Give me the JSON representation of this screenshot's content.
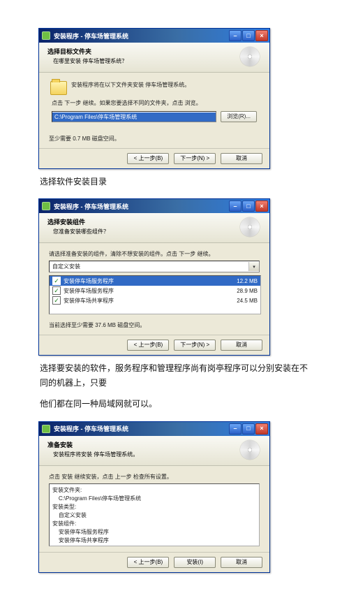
{
  "common": {
    "title": "安装程序 - 停车场管理系统",
    "minimize": "–",
    "maximize": "□",
    "close": "×",
    "prev": "< 上一步(B)",
    "next": "下一步(N) >",
    "cancel": "取消",
    "install": "安装(I)"
  },
  "d1": {
    "h1": "选择目标文件夹",
    "h2": "在哪里安装 停车场管理系统？",
    "folder_line": "安装程序将在以下文件夹安装 停车场管理系统。",
    "note": "点击 下一步 继续。如果您要选择不同的文件夹，点击 浏览。",
    "path": "C:\\Program Files\\停车场管理系统",
    "browse": "浏览(R)...",
    "space": "至少需要 0.7 MB 磁盘空间。"
  },
  "cap1": "选择软件安装目录",
  "d2": {
    "h1": "选择安装组件",
    "h2": "您准备安装哪些组件？",
    "note": "请选择准备安装的组件，清除不想安装的组件。点击 下一步 继续。",
    "combo": "自定义安装",
    "comp": [
      {
        "name": "安装停车场服务程序",
        "size": "12.2 MB",
        "selected": true
      },
      {
        "name": "安装停车场服务程序",
        "size": "28.9 MB",
        "selected": false
      },
      {
        "name": "安装停车场共享程序",
        "size": "24.5 MB",
        "selected": false
      }
    ],
    "space": "当前选择至少需要 37.6 MB 磁盘空间。"
  },
  "cap2a": "选择要安装的软件，服务程序和管理程序尚有岗亭程序可以分别安装在不同的机器上，只要",
  "cap2b": "他们都在同一种局域网就可以。",
  "d3": {
    "h1": "准备安装",
    "h2": "安装程序将安装 停车场管理系统。",
    "note": "点击 安装 继续安装，点击 上一步 检查所有设置。",
    "summary": "安装文件夹:\n    C:\\Program Files\\停车场管理系统\n安装类型:\n    自定义安装\n安装组件:\n    安装停车场服务程序\n    安装停车场共享程序\n开始菜单:\n    停车场管理系统"
  }
}
